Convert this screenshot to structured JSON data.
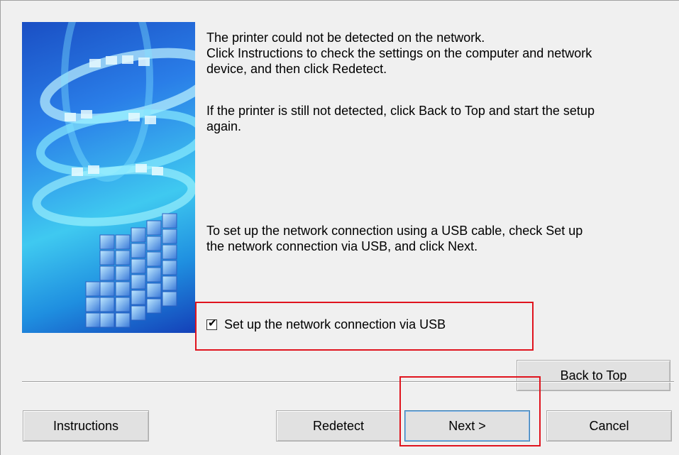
{
  "messages": {
    "not_detected_line1": "The printer could not be detected on the network.",
    "not_detected_line2": "Click Instructions to check the settings on the computer and network",
    "not_detected_line3": "device, and then click Redetect.",
    "still_not_detected_line1": "If the printer is still not detected, click Back to Top and start the setup",
    "still_not_detected_line2": "again.",
    "usb_instructions_line1": "To set up the network connection using a USB cable, check Set up",
    "usb_instructions_line2": "the network connection via USB, and click Next."
  },
  "usb_option": {
    "label": "Set up the network connection via USB",
    "checked": true
  },
  "buttons": {
    "back_to_top": "Back to Top",
    "instructions": "Instructions",
    "redetect": "Redetect",
    "next": "Next >",
    "cancel": "Cancel"
  },
  "colors": {
    "highlight": "#e0141e",
    "dialog_bg": "#f0f0f0",
    "button_bg": "#e1e1e1"
  },
  "icons": {
    "side_image": "printer-spiral-illustration",
    "checkbox_check": "checkmark-icon"
  }
}
